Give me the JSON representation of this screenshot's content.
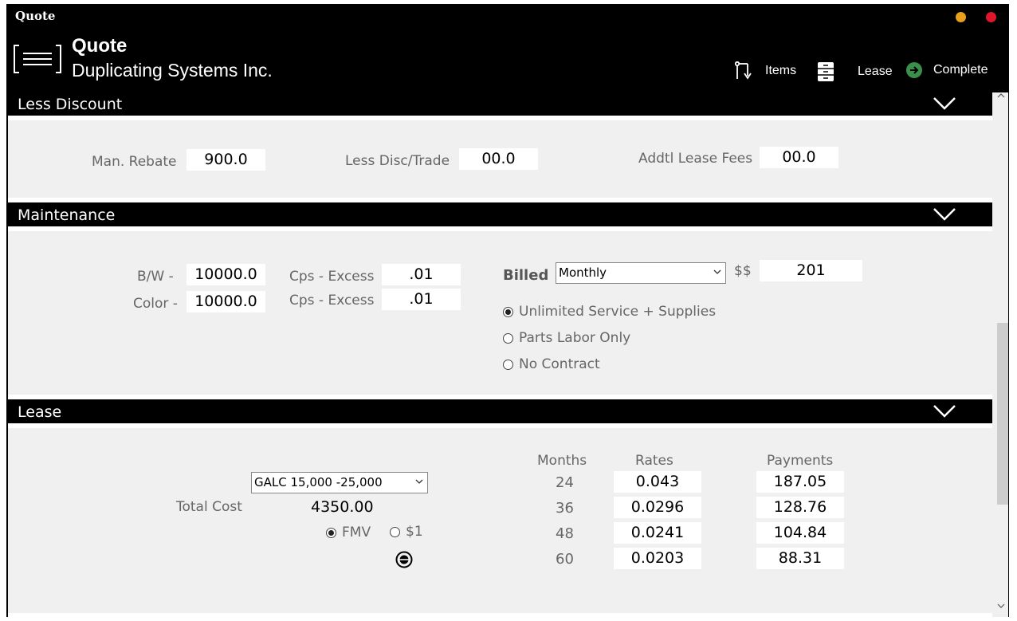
{
  "window": {
    "title": "Quote"
  },
  "header": {
    "title": "Quote",
    "company": "Duplicating Systems Inc.",
    "nav": {
      "items": "Items",
      "lease": "Lease",
      "complete": "Complete"
    }
  },
  "colors": {
    "accent_green": "#3a8f4a",
    "minimize": "#e6a01c",
    "close": "#e0162b"
  },
  "less_discount": {
    "title": "Less Discount",
    "man_rebate_label": "Man. Rebate",
    "man_rebate": "900.0",
    "less_disc_label": "Less Disc/Trade",
    "less_disc": "00.0",
    "addtl_fees_label": "Addtl Lease Fees",
    "addtl_fees": "00.0"
  },
  "maintenance": {
    "title": "Maintenance",
    "bw_label": "B/W -",
    "bw": "10000.0",
    "bw_cps_label": "Cps - Excess",
    "bw_cps": ".01",
    "color_label": "Color -",
    "color": "10000.0",
    "color_cps_label": "Cps - Excess",
    "color_cps": ".01",
    "billed_label": "Billed",
    "billed": "Monthly",
    "dollars_label": "$$",
    "dollars": "201",
    "options": [
      "Unlimited Service + Supplies",
      "Parts Labor Only",
      "No Contract"
    ],
    "selected_option": "Unlimited Service + Supplies"
  },
  "lease": {
    "title": "Lease",
    "program": "GALC 15,000 -25,000",
    "total_cost_label": "Total Cost",
    "total_cost": "4350.00",
    "fmv_label": "FMV",
    "dollar1_label": "$1",
    "selected_type": "FMV",
    "headers": {
      "months": "Months",
      "rates": "Rates",
      "payments": "Payments"
    },
    "rows": [
      {
        "months": "24",
        "rate": "0.043",
        "payment": "187.05"
      },
      {
        "months": "36",
        "rate": "0.0296",
        "payment": "128.76"
      },
      {
        "months": "48",
        "rate": "0.0241",
        "payment": "104.84"
      },
      {
        "months": "60",
        "rate": "0.0203",
        "payment": "88.31"
      }
    ]
  }
}
